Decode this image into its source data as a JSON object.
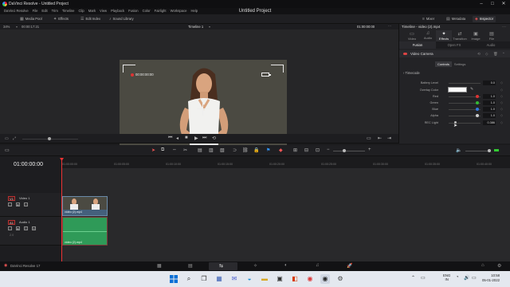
{
  "window": {
    "title": "DaVinci Resolve - Untitled Project",
    "min": "–",
    "max": "□",
    "close": "✕"
  },
  "menu": {
    "items": [
      "DaVinci Resolve",
      "File",
      "Edit",
      "Trim",
      "Timeline",
      "Clip",
      "Mark",
      "View",
      "Playback",
      "Fusion",
      "Color",
      "Fairlight",
      "Workspace",
      "Help"
    ],
    "project_title": "Untitled Project"
  },
  "toolbar": {
    "media_pool": "Media Pool",
    "effects": "Effects",
    "edit_index": "Edit Index",
    "sound_library": "Sound Library",
    "mixer": "Mixer",
    "metadata": "Metadata",
    "inspector": "Inspector"
  },
  "viewer": {
    "zoom": "34%",
    "source_tc": "00:00:17:21",
    "timeline_name": "Timeline 1",
    "record_tc": "01:00:00:00",
    "overlay_time": "00:00:00:00"
  },
  "inspector": {
    "title": "Timeline - video (2).mp4",
    "tabs": [
      {
        "label": "Video",
        "icon": "▭"
      },
      {
        "label": "Audio",
        "icon": "♫"
      },
      {
        "label": "Effects",
        "icon": "✦"
      },
      {
        "label": "Transition",
        "icon": "⇄"
      },
      {
        "label": "Image",
        "icon": "▣"
      },
      {
        "label": "File",
        "icon": "▤"
      }
    ],
    "sub_tabs": [
      "Fusion",
      "Open FX",
      "Audio"
    ],
    "effect_name": "Video Camera",
    "control_tabs": [
      "Controls",
      "Settings"
    ],
    "section": "Timecode",
    "params": [
      {
        "label": "Battery Level",
        "value": "0.0"
      },
      {
        "label": "Overlay Color",
        "value": ""
      },
      {
        "label": "Red",
        "value": "1.0",
        "dot": "#d33"
      },
      {
        "label": "Green",
        "value": "1.0",
        "dot": "#3b3"
      },
      {
        "label": "Blue",
        "value": "1.0",
        "dot": "#37d"
      },
      {
        "label": "Alpha",
        "value": "1.0",
        "dot": "#ccc"
      },
      {
        "label": "REC Light",
        "value": "0.386"
      }
    ]
  },
  "timeline": {
    "timecode": "01:00:00:00",
    "ruler_labels": [
      "01:00:00:00",
      "01:00:05:00",
      "01:00:10:00",
      "01:00:15:00",
      "01:00:20:00",
      "01:00:25:00",
      "01:00:30:00",
      "01:00:35:00",
      "01:00:40:00"
    ],
    "video_track": {
      "id": "V1",
      "name": "Video 1"
    },
    "audio_track": {
      "id": "A1",
      "name": "Audio 1",
      "level": "2.0"
    },
    "video_clip": "video (2).mp4",
    "audio_clip": "video (2).mp4"
  },
  "footer": {
    "app_name": "DaVinci Resolve 17"
  },
  "taskbar": {
    "lang_line1": "ENG",
    "lang_line2": "IN",
    "time": "10:58",
    "date": "05-01-2022"
  }
}
